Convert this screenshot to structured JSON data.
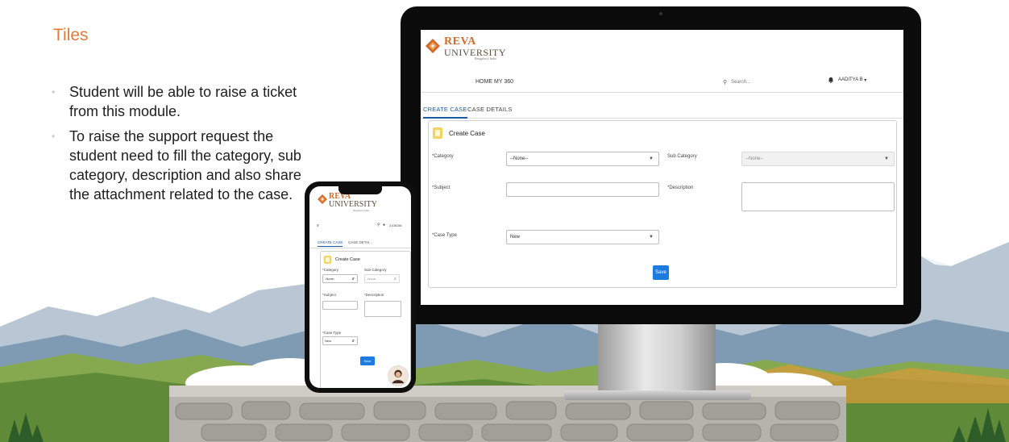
{
  "slide": {
    "title": "Tiles",
    "bullets": [
      "Student will be able to raise a ticket from this module.",
      "To raise the support request the student need to fill the category, sub category, description and also share the attachment related to the case."
    ]
  },
  "colors": {
    "title": "#e07b39",
    "accent": "#1b5aa6",
    "save_button": "#1b7be0",
    "card_icon": "#f4d35e"
  },
  "desktop": {
    "logo": {
      "line1": "REVA",
      "line2": "UNIVERSITY",
      "line3": "Bengaluru, India"
    },
    "nav": {
      "home": "HOME",
      "my360": "MY 360"
    },
    "search_placeholder": "Search...",
    "user_name": "AADITYA B",
    "tabs": {
      "create_case": "CREATE CASE",
      "case_details": "CASE DETAILS"
    },
    "card_title": "Create Case",
    "form": {
      "category_label": "*Category",
      "category_value": "--None--",
      "sub_category_label": "Sub Category",
      "sub_category_value": "--None--",
      "subject_label": "*Subject",
      "description_label": "*Description",
      "case_type_label": "*Case Type",
      "case_type_value": "New",
      "save_label": "Save"
    }
  },
  "mobile": {
    "logo": {
      "line1": "REVA",
      "line2": "UNIVERSITY",
      "line3": "Bengaluru, India"
    },
    "user_id": "2108156",
    "tabs": {
      "create_case": "CREATE CASE",
      "case_details": "CASE DETAI..."
    },
    "card_title": "Create Case",
    "form": {
      "category_label": "*Category",
      "category_value": "-None-",
      "sub_category_label": "Sub Category",
      "sub_category_value": "-None-",
      "subject_label": "*Subject",
      "description_label": "*Description",
      "case_type_label": "*Case Type",
      "case_type_value": "New",
      "save_label": "Save"
    }
  }
}
